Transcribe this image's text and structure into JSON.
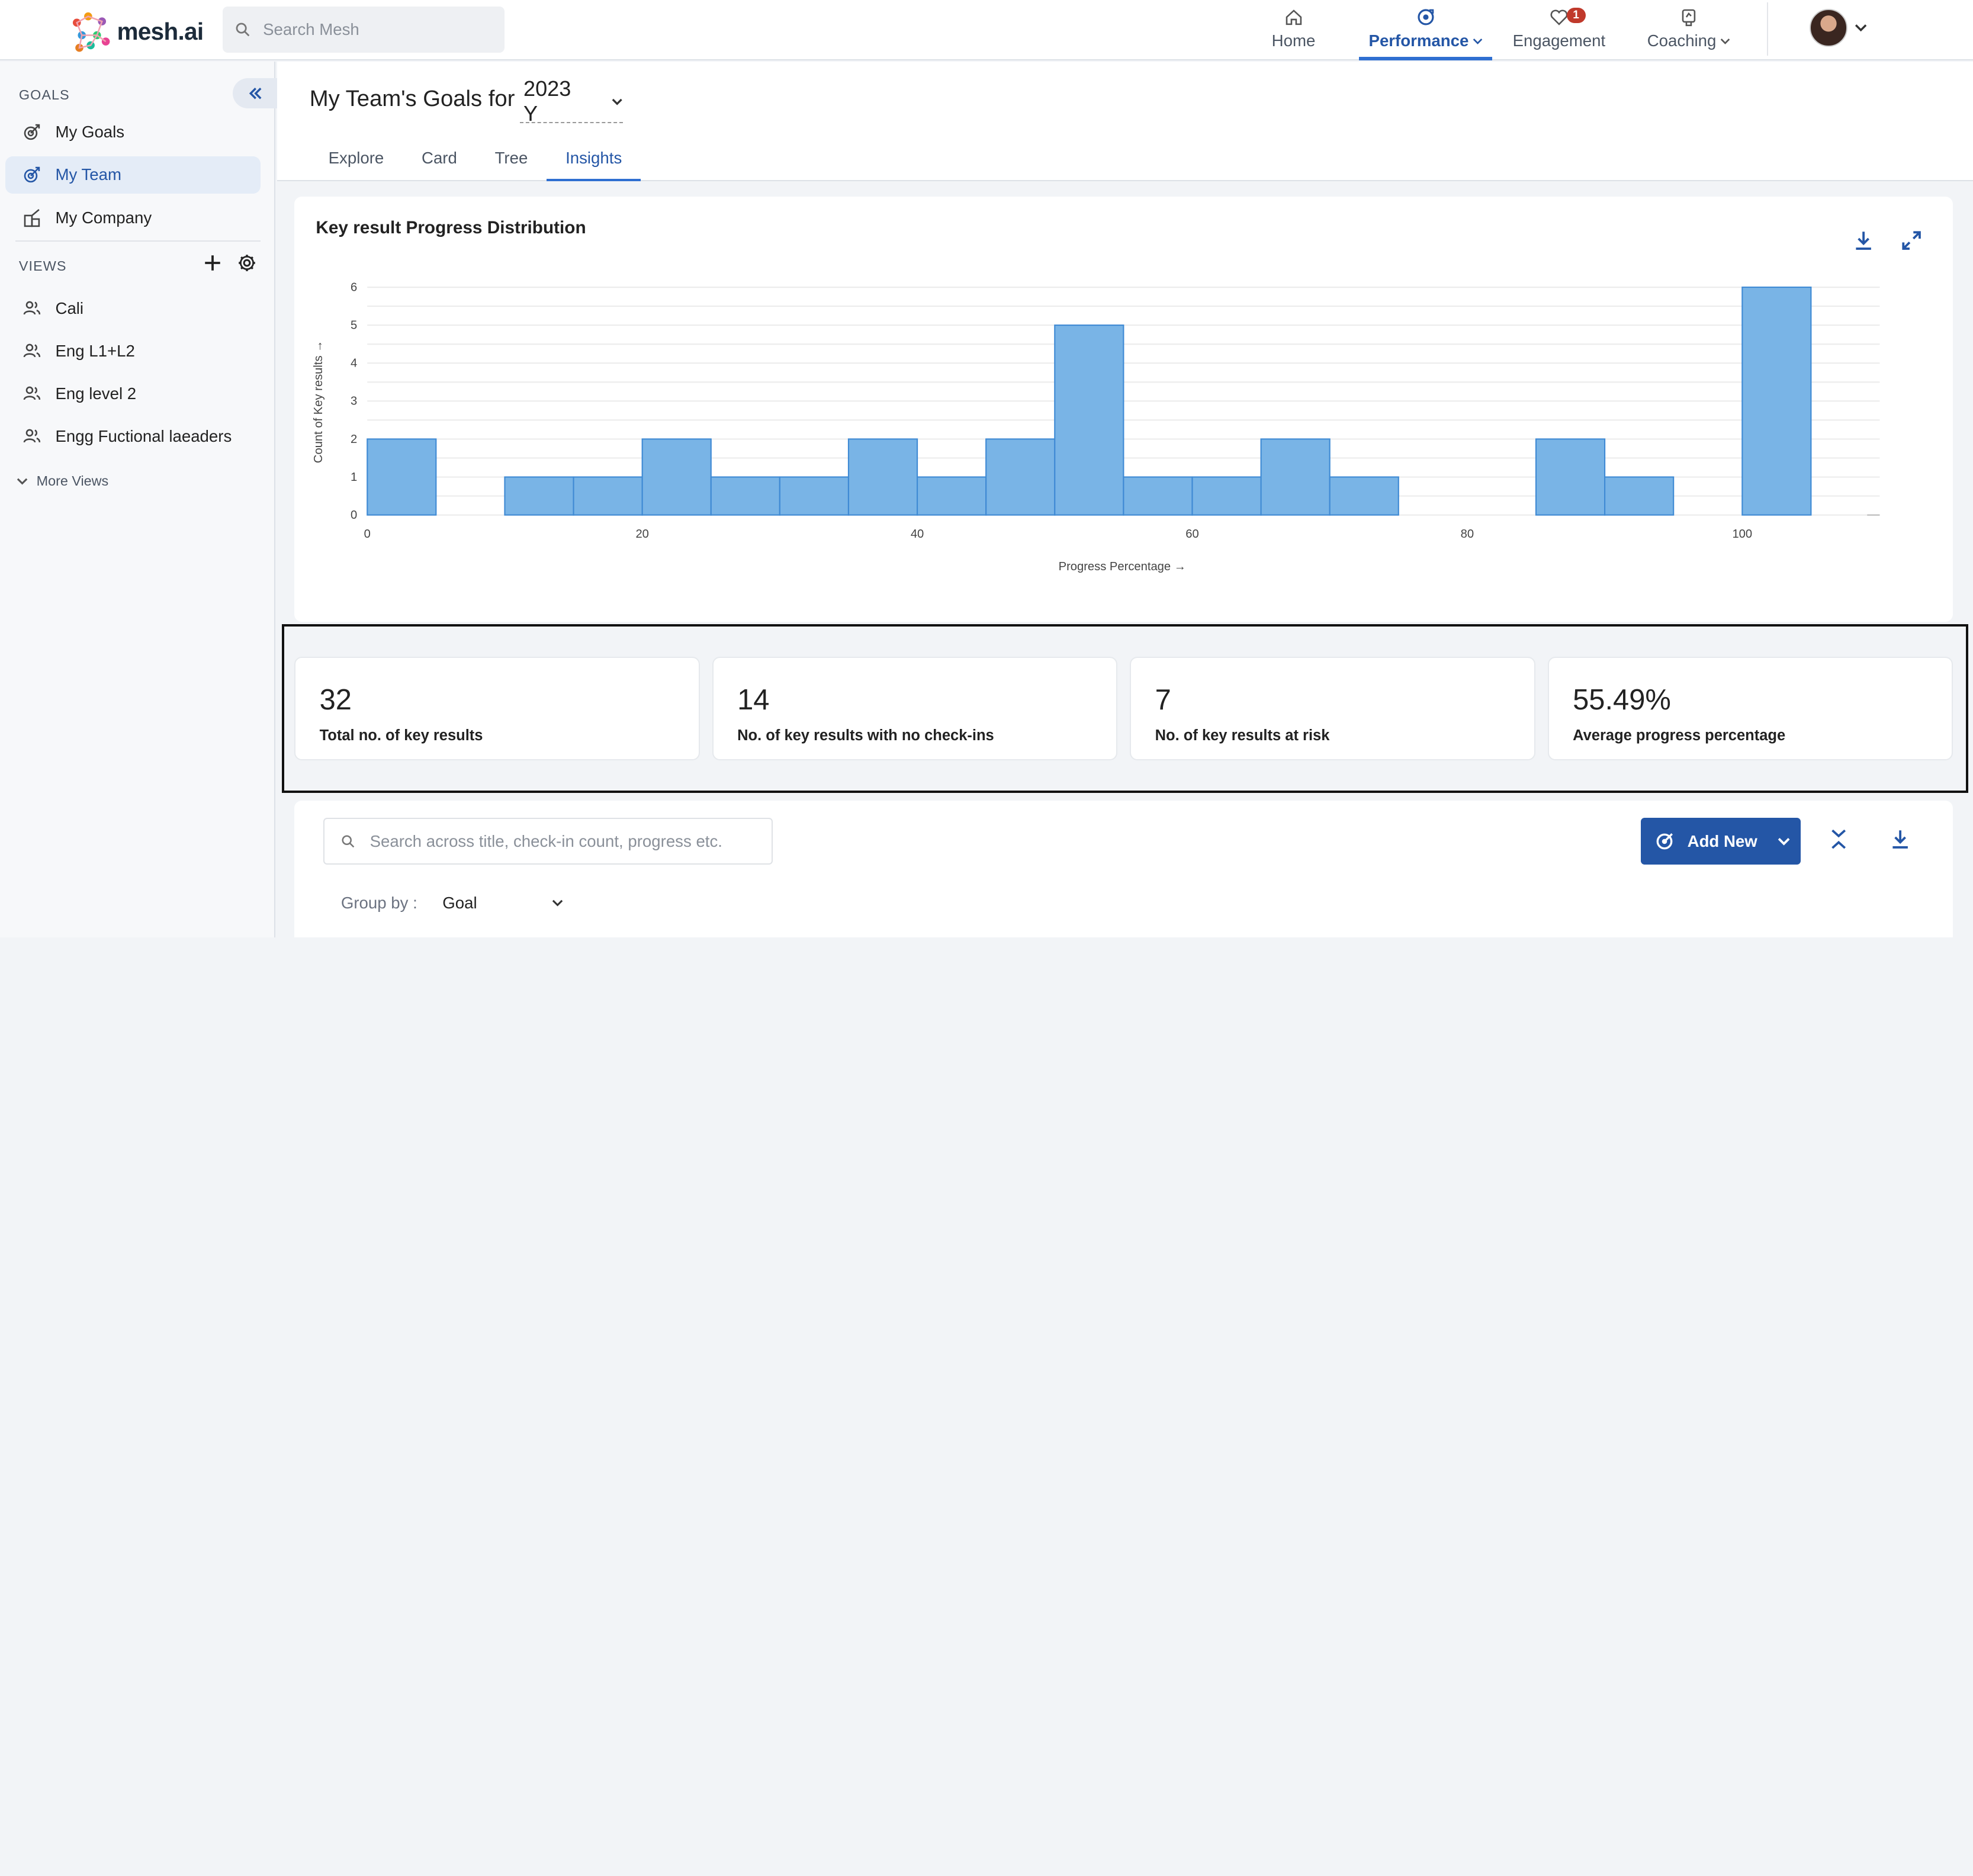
{
  "brand": {
    "name": "mesh.ai"
  },
  "search": {
    "placeholder": "Search Mesh"
  },
  "nav": {
    "items": [
      {
        "label": "Home",
        "icon": "home-icon"
      },
      {
        "label": "Performance",
        "icon": "performance-icon",
        "active": true
      },
      {
        "label": "Engagement",
        "icon": "engagement-icon",
        "badge": "1"
      },
      {
        "label": "Coaching",
        "icon": "coaching-icon"
      }
    ]
  },
  "sidebar": {
    "goals_heading": "GOALS",
    "goals": [
      {
        "label": "My Goals",
        "icon": "goal-icon"
      },
      {
        "label": "My Team",
        "icon": "goal-icon",
        "active": true
      },
      {
        "label": "My Company",
        "icon": "company-icon"
      }
    ],
    "views_heading": "VIEWS",
    "views": [
      {
        "label": "Cali",
        "icon": "people-icon"
      },
      {
        "label": "Eng L1+L2",
        "icon": "people-icon"
      },
      {
        "label": "Eng level 2",
        "icon": "people-icon"
      },
      {
        "label": "Engg Fuctional laeaders",
        "icon": "people-icon"
      }
    ],
    "more_views": "More Views"
  },
  "header": {
    "title": "My Team's Goals for",
    "year": "2023 Y",
    "tabs": [
      "Explore",
      "Card",
      "Tree",
      "Insights"
    ],
    "active_tab": "Insights"
  },
  "chart_data": {
    "type": "bar",
    "title": "Key result Progress Distribution",
    "xlabel": "Progress Percentage →",
    "ylabel": "Count of Key results →",
    "xlim": [
      0,
      110
    ],
    "ylim": [
      0,
      6
    ],
    "xticks": [
      0,
      20,
      40,
      60,
      80,
      100
    ],
    "yticks": [
      0,
      1,
      2,
      3,
      4,
      5,
      6
    ],
    "bin_width": 5,
    "bins": [
      {
        "x0": 0,
        "count": 2
      },
      {
        "x0": 5,
        "count": 0
      },
      {
        "x0": 10,
        "count": 1
      },
      {
        "x0": 15,
        "count": 1
      },
      {
        "x0": 20,
        "count": 2
      },
      {
        "x0": 25,
        "count": 1
      },
      {
        "x0": 30,
        "count": 1
      },
      {
        "x0": 35,
        "count": 2
      },
      {
        "x0": 40,
        "count": 1
      },
      {
        "x0": 45,
        "count": 2
      },
      {
        "x0": 50,
        "count": 5
      },
      {
        "x0": 55,
        "count": 1
      },
      {
        "x0": 60,
        "count": 1
      },
      {
        "x0": 65,
        "count": 2
      },
      {
        "x0": 70,
        "count": 1
      },
      {
        "x0": 75,
        "count": 0
      },
      {
        "x0": 80,
        "count": 0
      },
      {
        "x0": 85,
        "count": 2
      },
      {
        "x0": 90,
        "count": 1
      },
      {
        "x0": 95,
        "count": 0
      },
      {
        "x0": 100,
        "count": 6
      }
    ],
    "bar_color": "#79b4e6",
    "bar_stroke": "#3f8ad4",
    "grid": true
  },
  "kpis": [
    {
      "value": "32",
      "label": "Total no. of key results"
    },
    {
      "value": "14",
      "label": "No. of key results with no check-ins"
    },
    {
      "value": "7",
      "label": "No. of key results at risk"
    },
    {
      "value": "55.49%",
      "label": "Average progress percentage"
    }
  ],
  "list": {
    "search_placeholder": "Search across title, check-in count, progress etc.",
    "add_new": "Add New",
    "group_by_label": "Group by :",
    "group_by_value": "Goal"
  },
  "colors": {
    "accent": "#2456a6",
    "active_tab": "#2f6fd1",
    "badge": "#c0392b"
  }
}
